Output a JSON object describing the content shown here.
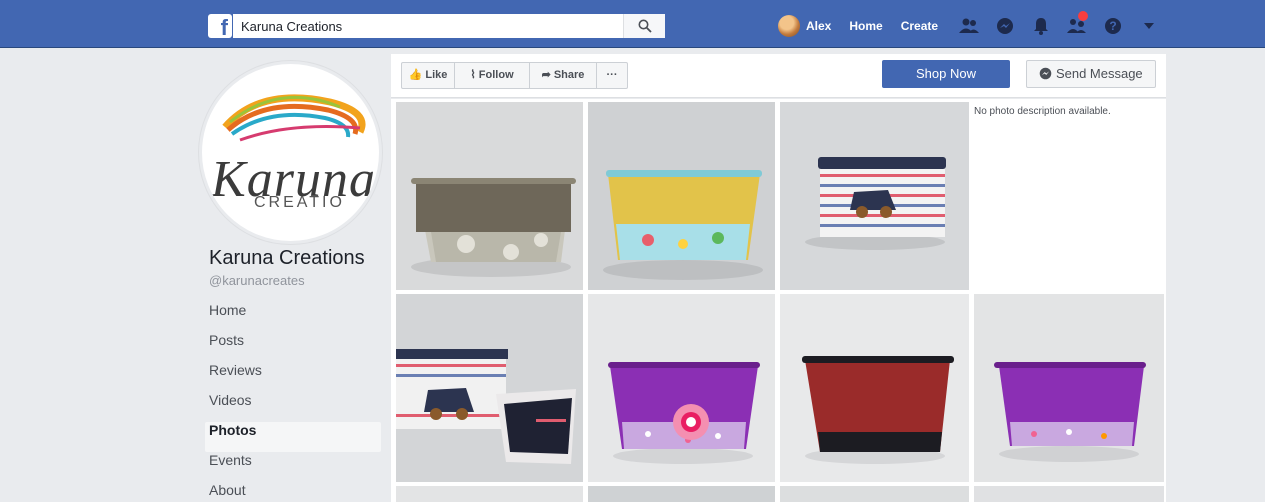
{
  "topbar": {
    "logo_letter": "f",
    "search_value": "Karuna Creations",
    "user_name": "Alex",
    "home_label": "Home",
    "create_label": "Create",
    "icons": [
      "friends-icon",
      "messenger-icon",
      "bell-icon",
      "friend-requests-icon",
      "help-icon",
      "chevron-down-icon"
    ]
  },
  "profile": {
    "logo_word": "Karuna",
    "logo_sub": "CREATIO",
    "name": "Karuna Creations",
    "handle": "@karunacreates"
  },
  "sidebar": {
    "items": [
      {
        "label": "Home"
      },
      {
        "label": "Posts"
      },
      {
        "label": "Reviews"
      },
      {
        "label": "Videos"
      },
      {
        "label": "Photos",
        "active": true
      },
      {
        "label": "Events"
      },
      {
        "label": "About"
      }
    ]
  },
  "actions": {
    "like": "Like",
    "follow": "Follow",
    "share": "Share",
    "more": "···",
    "shop_now": "Shop Now",
    "send_message": "Send Message"
  },
  "photos": {
    "no_description": "No photo description available."
  },
  "colors": {
    "brand": "#4267b2",
    "background": "#e9ebee",
    "notification": "#fa3e3e"
  }
}
